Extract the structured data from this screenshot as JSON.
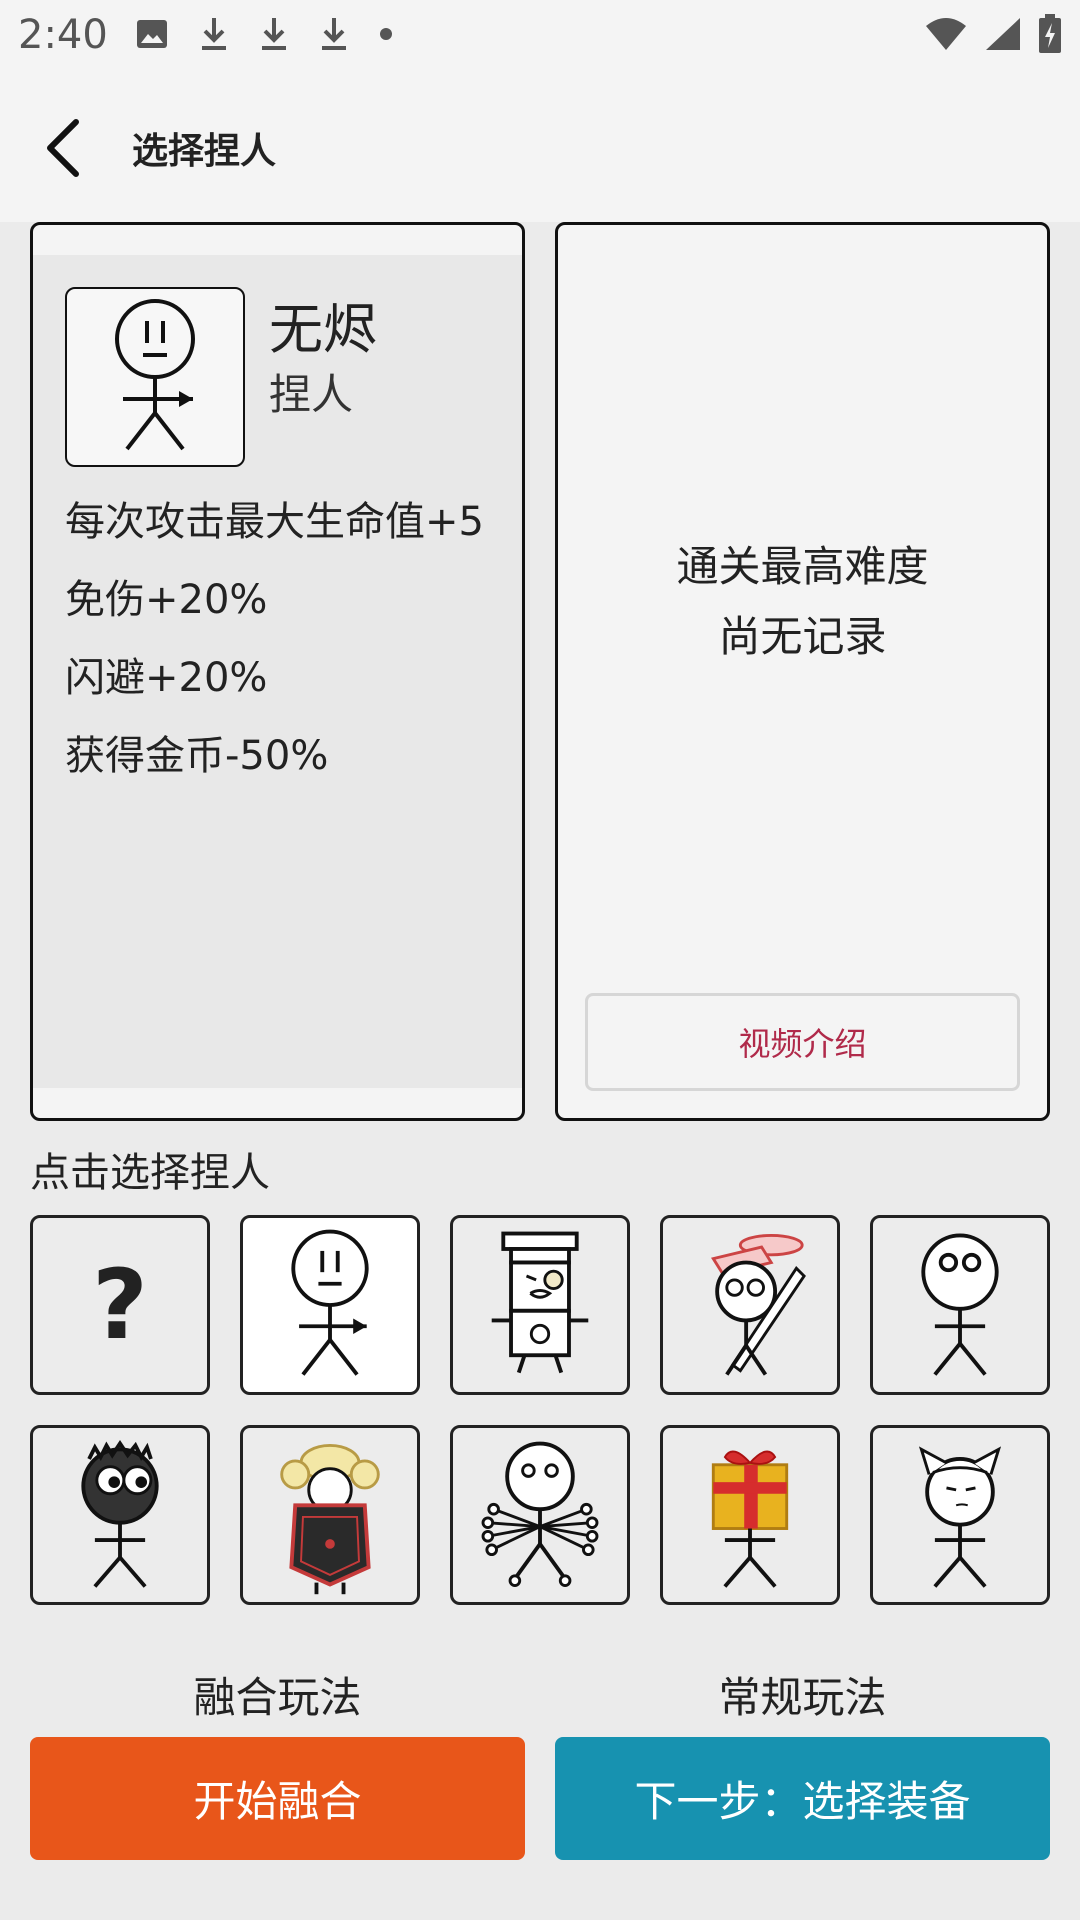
{
  "status_bar": {
    "time": "2:40",
    "left_icons": [
      "image-icon",
      "download-icon",
      "download-icon",
      "download-icon",
      "dot-icon"
    ],
    "right_icons": [
      "wifi-icon",
      "signal-icon",
      "battery-icon"
    ]
  },
  "app_bar": {
    "title": "选择捏人",
    "back_icon": "back-arrow-icon"
  },
  "character": {
    "name": "无烬",
    "type": "捏人",
    "effects": [
      "每次攻击最大生命值+5",
      "免伤+20%",
      "闪避+20%",
      "获得金币-50%"
    ]
  },
  "record": {
    "title": "通关最高难度",
    "value": "尚无记录",
    "video_button": "视频介绍"
  },
  "select_hint": "点击选择捏人",
  "grid": {
    "selected_index": 1,
    "cells": [
      {
        "icon": "question-mark-icon",
        "text": "?"
      },
      {
        "icon": "stick-figure-arrow-icon"
      },
      {
        "icon": "top-hat-monocle-figure-icon"
      },
      {
        "icon": "graduate-sword-figure-icon"
      },
      {
        "icon": "round-eyes-stick-figure-icon"
      },
      {
        "icon": "black-head-figure-icon"
      },
      {
        "icon": "shield-chef-figure-icon"
      },
      {
        "icon": "multi-arm-figure-icon"
      },
      {
        "icon": "gift-box-figure-icon"
      },
      {
        "icon": "cat-ear-figure-icon"
      }
    ]
  },
  "modes": {
    "fusion": {
      "label": "融合玩法",
      "button": "开始融合"
    },
    "normal": {
      "label": "常规玩法",
      "button": "下一步：选择装备"
    }
  },
  "colors": {
    "fusion_button": "#e8561a",
    "next_button": "#1792b0",
    "video_text": "#b02a4a"
  }
}
